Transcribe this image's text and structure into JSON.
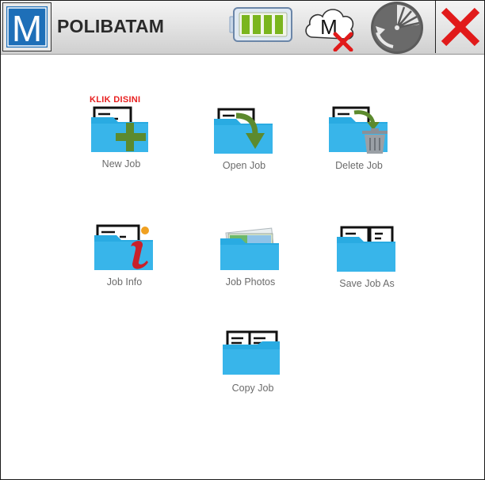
{
  "header": {
    "logo_letter": "M",
    "title": "POLIBATAM",
    "battery_icon": "battery-full-icon",
    "cloud_icon": "cloud-disconnected-icon",
    "cloud_letter": "M",
    "gauge_icon": "gauge-icon",
    "close_icon": "close-icon"
  },
  "hint": "KLIK DISINI",
  "colors": {
    "folder": "#29abe2",
    "close": "#e11a1a",
    "plus": "#5c8a2e",
    "hint": "#e82020"
  },
  "menu": [
    {
      "label": "New Job",
      "icon": "new-job-folder-icon"
    },
    {
      "label": "Open Job",
      "icon": "open-job-folder-icon"
    },
    {
      "label": "Delete Job",
      "icon": "delete-job-folder-icon"
    },
    {
      "label": "Job Info",
      "icon": "job-info-folder-icon"
    },
    {
      "label": "Job Photos",
      "icon": "job-photos-folder-icon"
    },
    {
      "label": "Save Job As",
      "icon": "save-job-as-folder-icon"
    },
    {
      "label": "Copy Job",
      "icon": "copy-job-folder-icon"
    }
  ]
}
